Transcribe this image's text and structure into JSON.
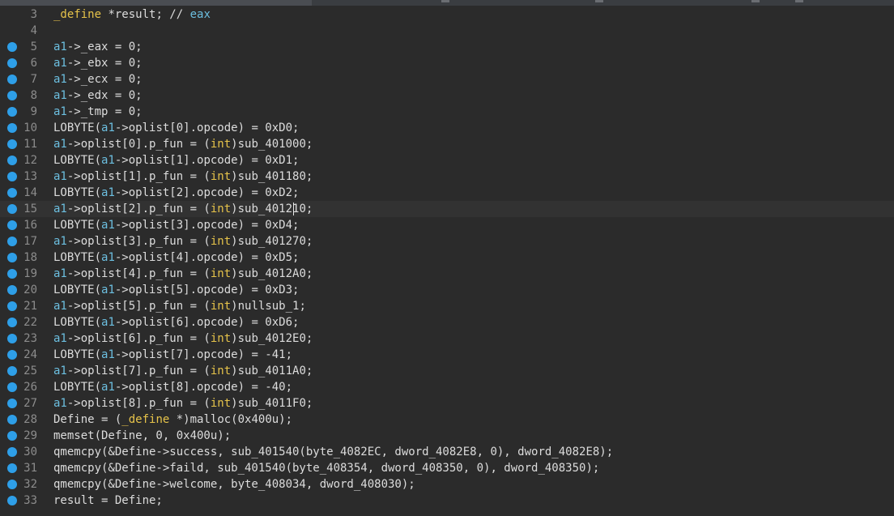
{
  "editor": {
    "lines": [
      {
        "n": "3",
        "bp": false,
        "text": "_define *result; // eax"
      },
      {
        "n": "4",
        "bp": false,
        "text": ""
      },
      {
        "n": "5",
        "bp": true,
        "text": "a1->_eax = 0;"
      },
      {
        "n": "6",
        "bp": true,
        "text": "a1->_ebx = 0;"
      },
      {
        "n": "7",
        "bp": true,
        "text": "a1->_ecx = 0;"
      },
      {
        "n": "8",
        "bp": true,
        "text": "a1->_edx = 0;"
      },
      {
        "n": "9",
        "bp": true,
        "text": "a1->_tmp = 0;"
      },
      {
        "n": "10",
        "bp": true,
        "text": "LOBYTE(a1->oplist[0].opcode) = 0xD0;"
      },
      {
        "n": "11",
        "bp": true,
        "text": "a1->oplist[0].p_fun = (int)sub_401000;"
      },
      {
        "n": "12",
        "bp": true,
        "text": "LOBYTE(a1->oplist[1].opcode) = 0xD1;"
      },
      {
        "n": "13",
        "bp": true,
        "text": "a1->oplist[1].p_fun = (int)sub_401180;"
      },
      {
        "n": "14",
        "bp": true,
        "text": "LOBYTE(a1->oplist[2].opcode) = 0xD2;"
      },
      {
        "n": "15",
        "bp": true,
        "text": "a1->oplist[2].p_fun = (int)sub_401210;"
      },
      {
        "n": "16",
        "bp": true,
        "text": "LOBYTE(a1->oplist[3].opcode) = 0xD4;"
      },
      {
        "n": "17",
        "bp": true,
        "text": "a1->oplist[3].p_fun = (int)sub_401270;"
      },
      {
        "n": "18",
        "bp": true,
        "text": "LOBYTE(a1->oplist[4].opcode) = 0xD5;"
      },
      {
        "n": "19",
        "bp": true,
        "text": "a1->oplist[4].p_fun = (int)sub_4012A0;"
      },
      {
        "n": "20",
        "bp": true,
        "text": "LOBYTE(a1->oplist[5].opcode) = 0xD3;"
      },
      {
        "n": "21",
        "bp": true,
        "text": "a1->oplist[5].p_fun = (int)nullsub_1;"
      },
      {
        "n": "22",
        "bp": true,
        "text": "LOBYTE(a1->oplist[6].opcode) = 0xD6;"
      },
      {
        "n": "23",
        "bp": true,
        "text": "a1->oplist[6].p_fun = (int)sub_4012E0;"
      },
      {
        "n": "24",
        "bp": true,
        "text": "LOBYTE(a1->oplist[7].opcode) = -41;"
      },
      {
        "n": "25",
        "bp": true,
        "text": "a1->oplist[7].p_fun = (int)sub_4011A0;"
      },
      {
        "n": "26",
        "bp": true,
        "text": "LOBYTE(a1->oplist[8].opcode) = -40;"
      },
      {
        "n": "27",
        "bp": true,
        "text": "a1->oplist[8].p_fun = (int)sub_4011F0;"
      },
      {
        "n": "28",
        "bp": true,
        "text": "Define = (_define *)malloc(0x400u);"
      },
      {
        "n": "29",
        "bp": true,
        "text": "memset(Define, 0, 0x400u);"
      },
      {
        "n": "30",
        "bp": true,
        "text": "qmemcpy(&Define->success, sub_401540(byte_4082EC, dword_4082E8, 0), dword_4082E8);"
      },
      {
        "n": "31",
        "bp": true,
        "text": "qmemcpy(&Define->faild, sub_401540(byte_408354, dword_408350, 0), dword_408350);"
      },
      {
        "n": "32",
        "bp": true,
        "text": "qmemcpy(&Define->welcome, byte_408034, dword_408030);"
      },
      {
        "n": "33",
        "bp": true,
        "text": "result = Define;"
      }
    ],
    "current_line": "15"
  },
  "colors": {
    "background": "#2b2b2b",
    "breakpoint": "#2e9fe8",
    "line_number": "#8c8c8c",
    "variable": "#6cbfe0",
    "type_keyword": "#e6c34a"
  }
}
